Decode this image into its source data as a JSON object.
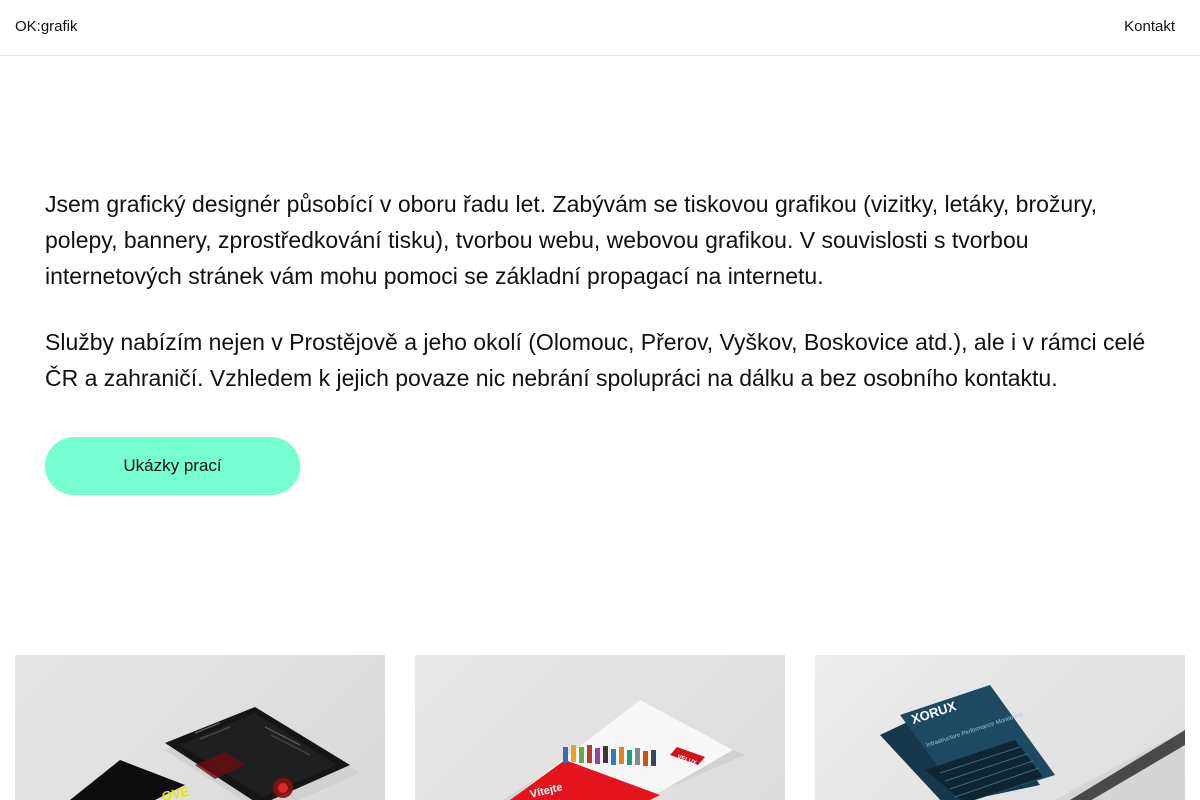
{
  "header": {
    "logo": "OK:grafik",
    "nav_contact": "Kontakt"
  },
  "intro": {
    "paragraph_1": "Jsem grafický designér působící v oboru řadu let. Zabývám se tiskovou grafikou (vizitky, letáky, brožury, polepy, bannery, zprostředkování tisku), tvorbou webu, webovou grafikou. V souvislosti s tvorbou internetových stránek vám mohu pomoci se základní propagací na internetu.",
    "paragraph_2": "Služby nabízím nejen v Prostějově a jeho okolí (Olomouc, Přerov, Vyškov, Boskovice atd.), ale i v rámci celé ČR a zahraničí. Vzhledem k jejich povaze nic nebrání spolupráci na dálku a bez osobního kontaktu.",
    "cta_label": "Ukázky prací"
  },
  "portfolio": {
    "items": [
      {
        "name": "dark-brochure",
        "visible_text": "OVE"
      },
      {
        "name": "velux-brochure",
        "visible_text": "Vítejte",
        "brand": "VELUX"
      },
      {
        "name": "xorux-leaflet",
        "visible_text": "XORUX",
        "tagline": "Infrastructure Performance Monitoring"
      }
    ]
  },
  "colors": {
    "accent": "#76fdd2",
    "text": "#111111",
    "divider": "#e6e6e6"
  }
}
